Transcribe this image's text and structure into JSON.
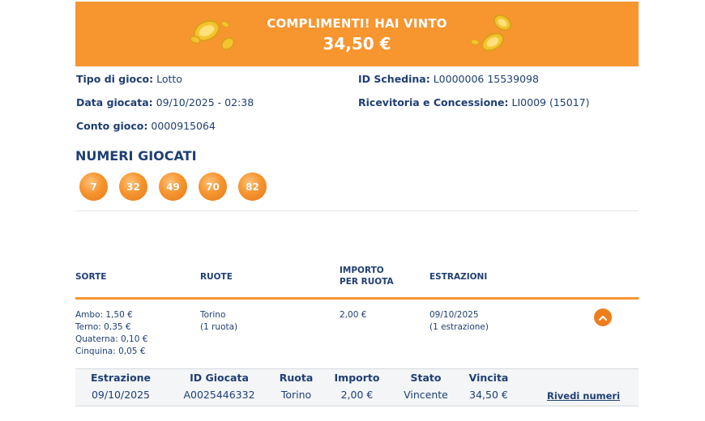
{
  "banner": {
    "title": "COMPLIMENTI! HAI VINTO",
    "amount": "34,50 €"
  },
  "info": {
    "game_type_label": "Tipo di gioco:",
    "game_type_value": "Lotto",
    "date_label": "Data giocata:",
    "date_value": "09/10/2025 - 02:38",
    "account_label": "Conto gioco:",
    "account_value": "0000915064",
    "ticket_label": "ID Schedina:",
    "ticket_value": "L0000006 15539098",
    "receiver_label": "Ricevitoria e Concessione:",
    "receiver_value": "LI0009 (15017)"
  },
  "numbers": {
    "title": "NUMERI GIOCATI",
    "values": [
      "7",
      "32",
      "49",
      "70",
      "82"
    ]
  },
  "table": {
    "headers": {
      "sorte": "SORTE",
      "ruote": "RUOTE",
      "importo_line1": "IMPORTO",
      "importo_line2": "PER RUOTA",
      "estrazioni": "ESTRAZIONI"
    },
    "row": {
      "sorte": [
        "Ambo: 1,50 €",
        "Terno: 0,35 €",
        "Quaterna: 0,10 €",
        "Cinquina: 0,05 €"
      ],
      "ruote_line1": "Torino",
      "ruote_line2": "(1 ruota)",
      "importo": "2,00 €",
      "estrazioni_line1": "09/10/2025",
      "estrazioni_line2": "(1 estrazione)"
    }
  },
  "detail": {
    "headers": {
      "estrazione": "Estrazione",
      "id_giocata": "ID Giocata",
      "ruota": "Ruota",
      "importo": "Importo",
      "stato": "Stato",
      "vincita": "Vincita"
    },
    "values": {
      "estrazione": "09/10/2025",
      "id_giocata": "A0025446332",
      "ruota": "Torino",
      "importo": "2,00 €",
      "stato": "Vincente",
      "vincita": "34,50 €"
    },
    "link": "Rivedi numeri"
  },
  "colors": {
    "accent": "#f7952f",
    "text": "#1f3f73"
  }
}
